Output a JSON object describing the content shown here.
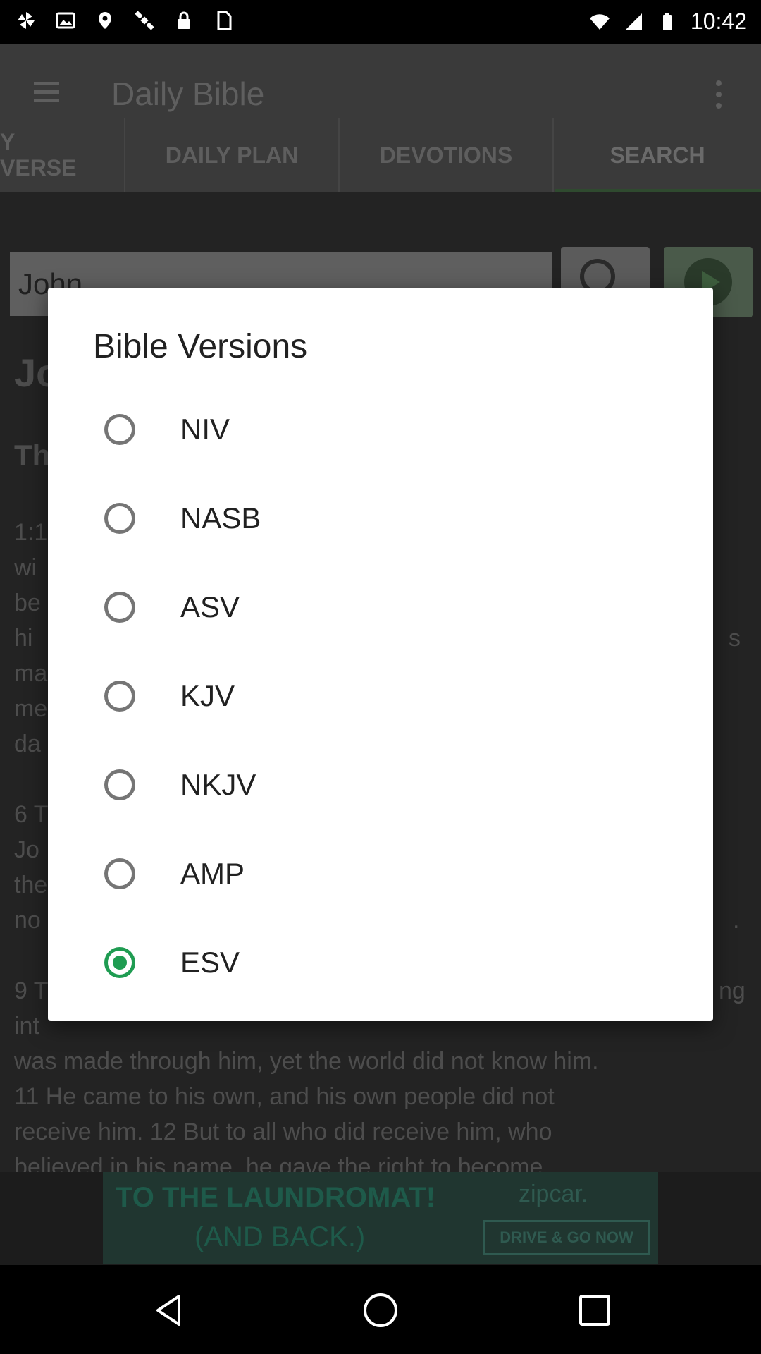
{
  "status_bar": {
    "time": "10:42",
    "left_icons": [
      "pinwheel-icon",
      "image-icon",
      "fake-gps-icon",
      "satellite-icon",
      "lock-icon",
      "sim-icon"
    ],
    "right_icons": [
      "wifi-icon",
      "signal-icon",
      "battery-icon"
    ]
  },
  "app_bar": {
    "title": "Daily Bible",
    "tabs": [
      "Y VERSE",
      "DAILY PLAN",
      "DEVOTIONS",
      "SEARCH"
    ],
    "active_tab": "SEARCH"
  },
  "search": {
    "value": "John"
  },
  "background_content": {
    "heading_partial": "Jo",
    "subheading_partial": "Th",
    "lines": [
      "1:1",
      "wi",
      "be",
      "hi",
      "ma",
      "me",
      "da",
      "6 T",
      "Jo",
      "the",
      "no",
      "9 T",
      "int",
      "was made through him, yet the world did not know him.",
      "11 He came to his own, and his own people did not",
      "receive him. 12 But to all who did receive him, who",
      "believed in his name, he gave the right to become"
    ],
    "right_edge_fragments": [
      "s",
      "ng",
      "."
    ]
  },
  "ad": {
    "line1": "TO THE LAUNDROMAT!",
    "line2": "(AND BACK.)",
    "brand": "zipcar.",
    "cta": "DRIVE & GO NOW"
  },
  "dialog": {
    "title": "Bible Versions",
    "options": [
      {
        "label": "NIV",
        "checked": false
      },
      {
        "label": "NASB",
        "checked": false
      },
      {
        "label": "ASV",
        "checked": false
      },
      {
        "label": "KJV",
        "checked": false
      },
      {
        "label": "NKJV",
        "checked": false
      },
      {
        "label": "AMP",
        "checked": false
      },
      {
        "label": "ESV",
        "checked": true
      }
    ],
    "accent_color": "#1f9c52"
  },
  "nav_bar": {
    "buttons": [
      "back-icon",
      "home-icon",
      "recents-icon"
    ]
  }
}
